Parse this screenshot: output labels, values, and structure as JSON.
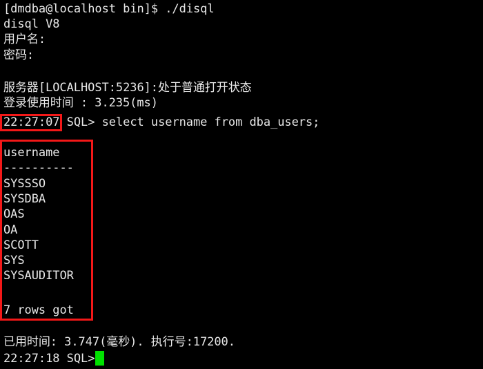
{
  "terminal": {
    "background_color": "#000000",
    "foreground_color": "#e8e8e8",
    "cursor_color": "#00e000",
    "annotation_color": "#f31818",
    "lines": {
      "prompt_command": "[dmdba@localhost bin]$ ./disql",
      "version": "disql V8",
      "username_prompt": "用户名:",
      "password_prompt": "密码:",
      "blank_1": "",
      "server_status": "服务器[LOCALHOST:5236]:处于普通打开状态",
      "login_time": "登录使用时间 : 3.235(ms)",
      "sql_timestamp": "22:27:07",
      "sql_prompt_and_query": " SQL> select username from dba_users;",
      "blank_2": "",
      "result_header": "username",
      "result_separator": "----------",
      "row_1": "SYSSSO",
      "row_2": "SYSDBA",
      "row_3": "OAS",
      "row_4": "OA",
      "row_5": "SCOTT",
      "row_6": "SYS",
      "row_7": "SYSAUDITOR",
      "blank_3": "",
      "row_count": "7 rows got",
      "blank_4": "",
      "elapsed_time": "已用时间: 3.747(毫秒). 执行号:17200.",
      "final_prompt": "22:27:18 SQL>"
    }
  }
}
